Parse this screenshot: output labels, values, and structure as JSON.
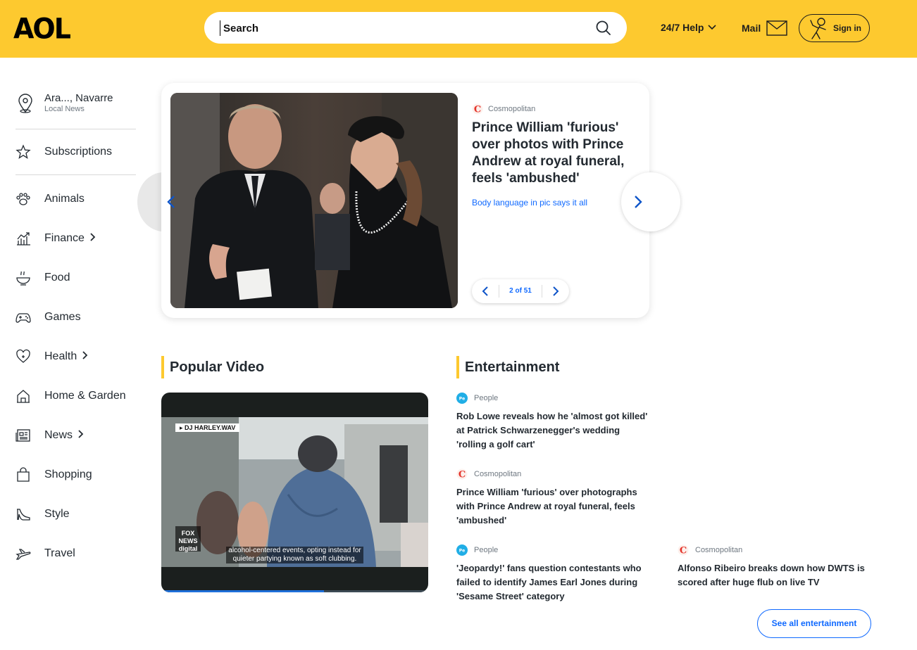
{
  "header": {
    "logo": "AOL",
    "search_placeholder": "Search",
    "help_label": "24/7 Help",
    "mail_label": "Mail",
    "signin_label": "Sign in",
    "brand_color": "#fdc92f"
  },
  "sidebar": {
    "location": {
      "name": "Ara..., Navarre",
      "subtitle": "Local News"
    },
    "subscriptions": "Subscriptions",
    "items": [
      {
        "label": "Animals",
        "icon": "paw-icon"
      },
      {
        "label": "Finance",
        "icon": "chart-icon"
      },
      {
        "label": "Food",
        "icon": "bowl-icon"
      },
      {
        "label": "Games",
        "icon": "gamepad-icon"
      },
      {
        "label": "Health",
        "icon": "heart-icon"
      },
      {
        "label": "Home & Garden",
        "icon": "house-icon"
      },
      {
        "label": "News",
        "icon": "newspaper-icon"
      },
      {
        "label": "Shopping",
        "icon": "bag-icon"
      },
      {
        "label": "Style",
        "icon": "heel-icon"
      },
      {
        "label": "Travel",
        "icon": "plane-icon"
      }
    ]
  },
  "hero": {
    "source": "Cosmopolitan",
    "title": "Prince William 'furious' over photos with Prince Andrew at royal funeral, feels 'ambushed'",
    "subtitle": "Body language in pic says it all",
    "pager": "2 of 51"
  },
  "popular_video": {
    "heading": "Popular Video",
    "tag": "DJ HARLEY.WAV",
    "caption_line1": "alcohol-centered events, opting instead for",
    "caption_line2": "quieter partying known as soft clubbing.",
    "watermark": "FOX NEWS digital",
    "progress": 0.61
  },
  "entertainment": {
    "heading": "Entertainment",
    "articles": [
      {
        "source": "People",
        "title": "Rob Lowe reveals how he 'almost got killed' at Patrick Schwarzenegger's wedding 'rolling a golf cart'"
      },
      {
        "source": "Cosmopolitan",
        "title": "Prince William 'furious' over photographs with Prince Andrew at royal funeral, feels 'ambushed'"
      },
      {
        "source": "People",
        "title": "'Jeopardy!' fans question contestants who failed to identify James Earl Jones during 'Sesame Street' category"
      },
      {
        "source": "Cosmopolitan",
        "title": "Alfonso Ribeiro breaks down how DWTS is scored after huge flub on live TV"
      }
    ],
    "see_all": "See all entertainment"
  }
}
